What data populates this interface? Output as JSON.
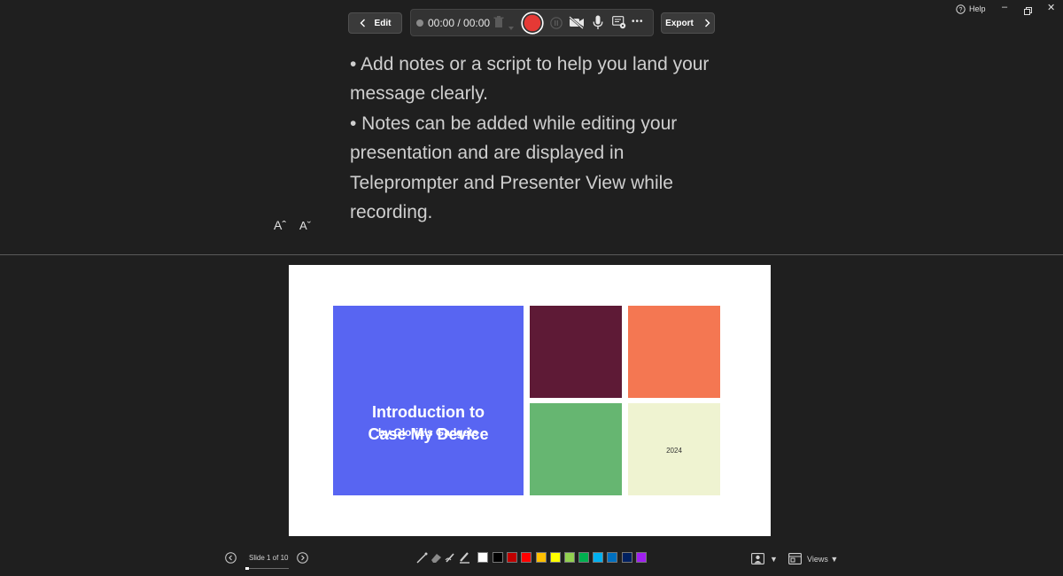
{
  "window": {
    "help_label": "Help",
    "minimize_glyph": "–",
    "restore_glyph": "🗗",
    "close_glyph": "✕"
  },
  "toolbar": {
    "edit_label": "Edit",
    "timer": "00:00 / 00:00",
    "export_label": "Export",
    "more_glyph": "•••",
    "icons": [
      "chevron-left-icon",
      "trash-icon",
      "record-icon",
      "pause-icon",
      "camera-off-icon",
      "microphone-icon",
      "screen-settings-icon",
      "more-icon",
      "chevron-right-icon"
    ]
  },
  "notes": {
    "lines": [
      "• Add notes or a script to help you land your message clearly.",
      "• Notes can be added while editing your presentation and are displayed in Teleprompter and Presenter View while recording."
    ],
    "font_increase": "Aˆ",
    "font_decrease": "Aˇ"
  },
  "slide": {
    "title_line1": "Introduction to",
    "title_line2": "Case My Device",
    "subtitle": "by Gloria's Gadgets",
    "year": "2024",
    "colors": {
      "title_tile": "#5865f2",
      "tile_top_left": "#5e1a36",
      "tile_top_right": "#f47752",
      "tile_bottom_left": "#66b671",
      "tile_bottom_right": "#eff3d1"
    }
  },
  "bottom_bar": {
    "slide_counter": "Slide 1 of 10",
    "views_label": "Views",
    "views_caret": "▼",
    "camera_caret": "▼",
    "pen_colors": [
      "#ffffff",
      "#000000",
      "#c00000",
      "#ff0000",
      "#ffc000",
      "#ffff00",
      "#92d050",
      "#00b050",
      "#00b0f0",
      "#0070c0",
      "#002060",
      "#a020f0"
    ]
  },
  "colors": {
    "background": "#1f1f1f",
    "record": "#e53935"
  }
}
